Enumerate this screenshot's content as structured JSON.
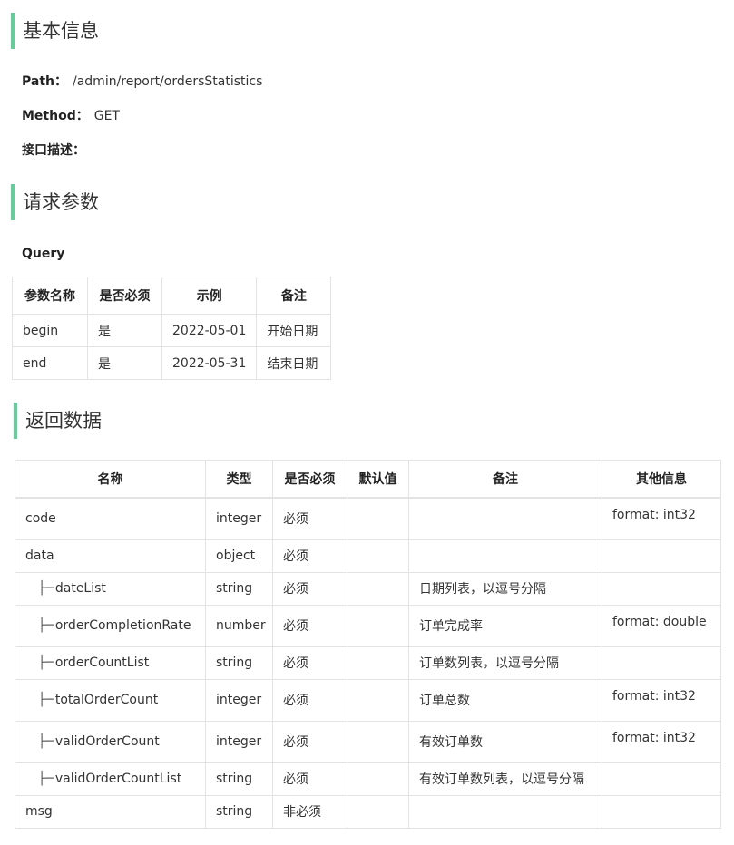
{
  "basic": {
    "title": "基本信息",
    "path_label": "Path：",
    "path_value": "/admin/report/ordersStatistics",
    "method_label": "Method：",
    "method_value": "GET",
    "desc_label": "接口描述："
  },
  "request": {
    "title": "请求参数",
    "query_label": "Query",
    "headers": [
      "参数名称",
      "是否必须",
      "示例",
      "备注"
    ],
    "rows": [
      {
        "name": "begin",
        "required": "是",
        "example": "2022-05-01",
        "note": "开始日期"
      },
      {
        "name": "end",
        "required": "是",
        "example": "2022-05-31",
        "note": "结束日期"
      }
    ]
  },
  "response": {
    "title": "返回数据",
    "tree_prefix": "├─",
    "headers": [
      "名称",
      "类型",
      "是否必须",
      "默认值",
      "备注",
      "其他信息"
    ],
    "rows": [
      {
        "name": "code",
        "type": "integer",
        "required": "必须",
        "default": "",
        "note": "",
        "other": "format: int32",
        "child": false
      },
      {
        "name": "data",
        "type": "object",
        "required": "必须",
        "default": "",
        "note": "",
        "other": "",
        "child": false
      },
      {
        "name": "dateList",
        "type": "string",
        "required": "必须",
        "default": "",
        "note": "日期列表，以逗号分隔",
        "other": "",
        "child": true
      },
      {
        "name": "orderCompletionRate",
        "type": "number",
        "required": "必须",
        "default": "",
        "note": "订单完成率",
        "other": "format: double",
        "child": true
      },
      {
        "name": "orderCountList",
        "type": "string",
        "required": "必须",
        "default": "",
        "note": "订单数列表，以逗号分隔",
        "other": "",
        "child": true
      },
      {
        "name": "totalOrderCount",
        "type": "integer",
        "required": "必须",
        "default": "",
        "note": "订单总数",
        "other": "format: int32",
        "child": true
      },
      {
        "name": "validOrderCount",
        "type": "integer",
        "required": "必须",
        "default": "",
        "note": "有效订单数",
        "other": "format: int32",
        "child": true
      },
      {
        "name": "validOrderCountList",
        "type": "string",
        "required": "必须",
        "default": "",
        "note": "有效订单数列表，以逗号分隔",
        "other": "",
        "child": true
      },
      {
        "name": "msg",
        "type": "string",
        "required": "非必须",
        "default": "",
        "note": "",
        "other": "",
        "child": false
      }
    ]
  },
  "colors": {
    "accent": "#5ed19b",
    "border": "#e3e3e3"
  }
}
